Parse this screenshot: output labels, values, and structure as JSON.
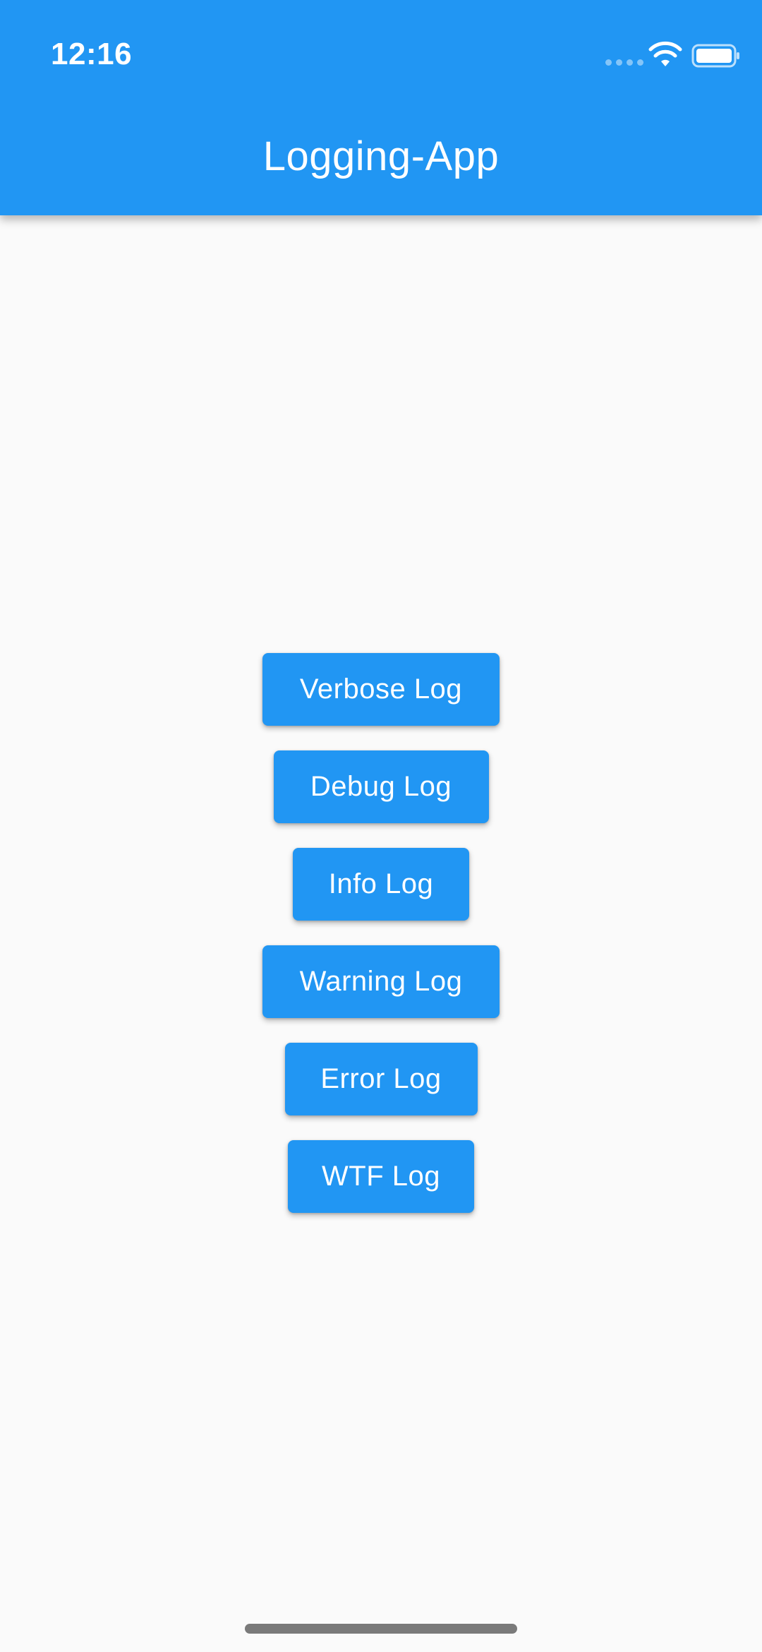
{
  "status_bar": {
    "time": "12:16",
    "icons": [
      "signal-dots-icon",
      "wifi-icon",
      "battery-icon"
    ]
  },
  "app_bar": {
    "title": "Logging-App"
  },
  "buttons": [
    {
      "label": "Verbose Log"
    },
    {
      "label": "Debug Log"
    },
    {
      "label": "Info Log"
    },
    {
      "label": "Warning Log"
    },
    {
      "label": "Error Log"
    },
    {
      "label": "WTF Log"
    }
  ],
  "colors": {
    "primary": "#2196F3",
    "background": "#FAFAFA",
    "on_primary": "#FFFFFF"
  }
}
